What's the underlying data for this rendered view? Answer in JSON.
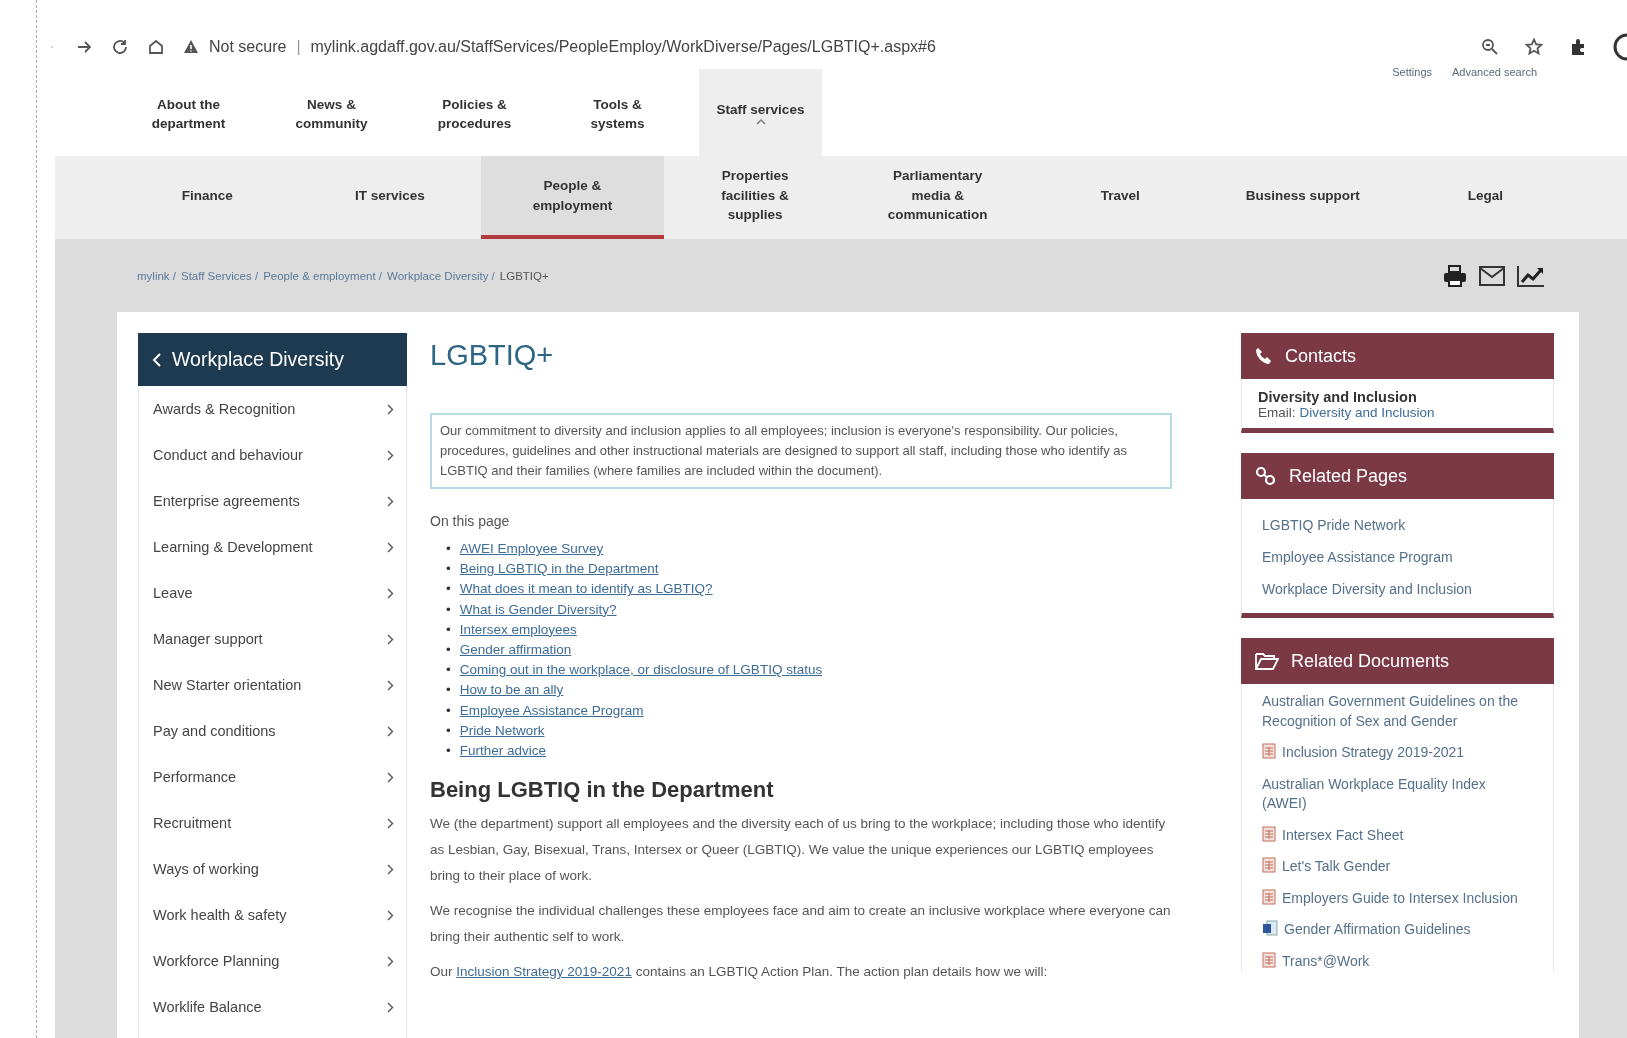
{
  "browser": {
    "security": "Not secure",
    "separator": "|",
    "url": "mylink.agdaff.gov.au/StaffServices/PeopleEmploy/WorkDiverse/Pages/LGBTIQ+.aspx#6"
  },
  "header_links": [
    "Settings",
    "Advanced search"
  ],
  "top_nav": [
    {
      "label": "About the department",
      "selected": false
    },
    {
      "label": "News & community",
      "selected": false
    },
    {
      "label": "Policies & procedures",
      "selected": false
    },
    {
      "label": "Tools & systems",
      "selected": false
    },
    {
      "label": "Staff services",
      "selected": true
    }
  ],
  "sub_nav": [
    {
      "label": "Finance",
      "selected": false
    },
    {
      "label": "IT services",
      "selected": false
    },
    {
      "label": "People & employment",
      "selected": true
    },
    {
      "label": "Properties facilities & supplies",
      "selected": false
    },
    {
      "label": "Parliamentary media & communication",
      "selected": false
    },
    {
      "label": "Travel",
      "selected": false
    },
    {
      "label": "Business support",
      "selected": false
    },
    {
      "label": "Legal",
      "selected": false
    }
  ],
  "breadcrumb": [
    "mylink /",
    "Staff Services /",
    "People & employment /",
    "Workplace Diversity /",
    "LGBTIQ+"
  ],
  "side_nav": {
    "title": "Workplace Diversity",
    "items": [
      "Awards & Recognition",
      "Conduct and behaviour",
      "Enterprise agreements",
      "Learning & Development",
      "Leave",
      "Manager support",
      "New Starter orientation",
      "Pay and conditions",
      "Performance",
      "Recruitment",
      "Ways of working",
      "Work health & safety",
      "Workforce Planning",
      "Worklife Balance"
    ]
  },
  "main": {
    "title": "LGBTIQ+",
    "intro": "Our commitment to diversity and inclusion applies to all employees; inclusion is everyone's responsibility. Our policies, procedures, guidelines and other instructional materials are designed to support all staff, including those who identify as LGBTIQ and their families (where families are included within the document).",
    "on_this_page": "On this page",
    "bullet": "•",
    "links": [
      "AWEI Employee Survey",
      "Being LGBTIQ in the Department",
      "What does it mean to identify as LGBTIQ?",
      "What is Gender Diversity?",
      "Intersex employees",
      "Gender affirmation",
      "Coming out in the workplace, or disclosure of LGBTIQ status",
      "How to be an ally",
      "Employee Assistance Program",
      "Pride Network",
      "Further advice"
    ],
    "heading": "Being LGBTIQ in the Department",
    "paragraphs": [
      {
        "text": "We (the department) support all employees and the diversity each of us bring to the workplace; including those who identify as Lesbian, Gay, Bisexual, Trans, Intersex or Queer (LGBTIQ). We value the unique experiences our LGBTIQ employees bring to their place of work."
      },
      {
        "text": "We recognise the individual challenges these employees face and aim to create an inclusive workplace where everyone can bring their authentic self to work."
      },
      {
        "text": "Our ",
        "link": "Inclusion Strategy 2019-2021",
        "after": " contains an LGBTIQ Action Plan. The action plan details how we will:"
      }
    ]
  },
  "contacts": {
    "title": "Contacts",
    "name": "Diversity and Inclusion",
    "email_label": "Email:",
    "email_link": "Diversity and Inclusion"
  },
  "related_pages": {
    "title": "Related Pages",
    "items": [
      "LGBTIQ Pride Network",
      "Employee Assistance Program",
      "Workplace Diversity and Inclusion"
    ]
  },
  "related_documents": {
    "title": "Related Documents",
    "items": [
      {
        "label": "Australian Government Guidelines on the Recognition of Sex and Gender",
        "kind": "plain"
      },
      {
        "label": "Inclusion Strategy 2019-2021",
        "kind": "file"
      },
      {
        "label": "Australian Workplace Equality Index (AWEI)",
        "kind": "plain"
      },
      {
        "label": "Intersex Fact Sheet",
        "kind": "file"
      },
      {
        "label": "Let's Talk Gender",
        "kind": "file"
      },
      {
        "label": "Employers Guide to Intersex Inclusion",
        "kind": "file"
      },
      {
        "label": "Gender Affirmation Guidelines",
        "kind": "word"
      },
      {
        "label": "Trans*@Work",
        "kind": "file"
      }
    ]
  }
}
